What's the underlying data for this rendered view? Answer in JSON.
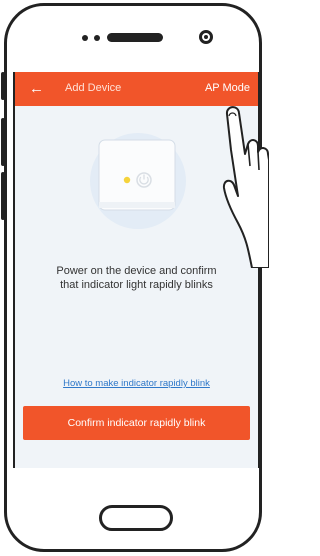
{
  "appbar": {
    "back_icon": "←",
    "title": "Add Device",
    "ap_mode_label": "AP Mode"
  },
  "main": {
    "instruction_line1": "Power on the device and confirm",
    "instruction_line2": "that indicator light rapidly blinks",
    "howto_link": "How to make indicator rapidly blink",
    "confirm_button": "Confirm indicator rapidly blink"
  },
  "colors": {
    "accent": "#f1552a",
    "link": "#2f78c9",
    "indicator": "#f5d33b"
  },
  "icons": [
    "back-arrow-icon",
    "power-icon",
    "indicator-light-icon",
    "pointing-hand-icon"
  ]
}
